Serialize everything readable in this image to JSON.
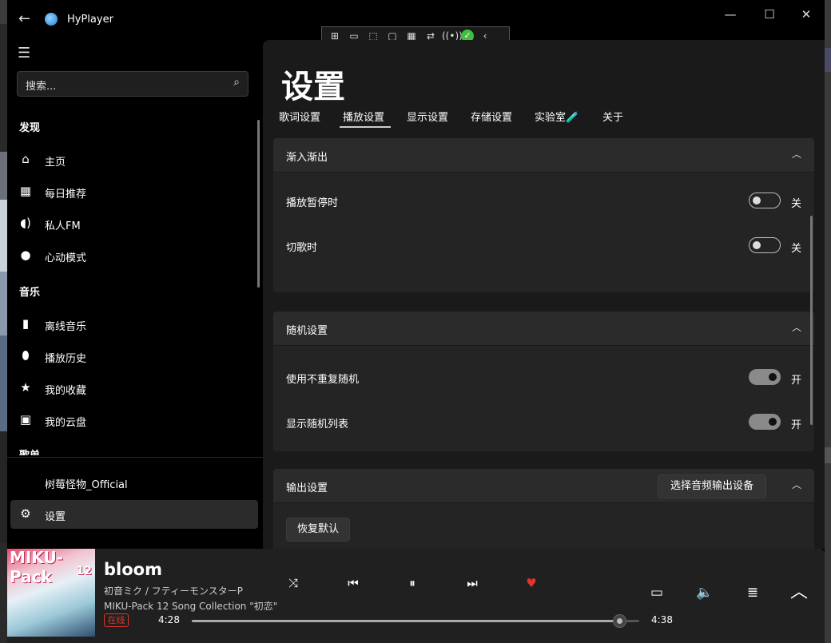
{
  "window": {
    "title": "HyPlayer"
  },
  "sidebar": {
    "search_placeholder": "搜索...",
    "sections": {
      "discover": "发现",
      "music": "音乐",
      "playlists": "歌单"
    },
    "discover_items": [
      {
        "label": "主页",
        "icon": "home-icon"
      },
      {
        "label": "每日推荐",
        "icon": "calendar-icon"
      },
      {
        "label": "私人FM",
        "icon": "radio-icon"
      },
      {
        "label": "心动模式",
        "icon": "lightbulb-icon"
      }
    ],
    "music_items": [
      {
        "label": "离线音乐",
        "icon": "document-icon"
      },
      {
        "label": "播放历史",
        "icon": "location-icon"
      },
      {
        "label": "我的收藏",
        "icon": "star-icon"
      },
      {
        "label": "我的云盘",
        "icon": "briefcase-icon"
      }
    ],
    "user": "树莓怪物_Official",
    "settings": "设置"
  },
  "content": {
    "title": "设置",
    "tabs": [
      "歌词设置",
      "播放设置",
      "显示设置",
      "存储设置",
      "实验室🧪",
      "关于"
    ],
    "active_tab_index": 1,
    "fade": {
      "title": "渐入渐出",
      "rows": [
        {
          "label": "播放暂停时",
          "on": false,
          "state": "关"
        },
        {
          "label": "切歌时",
          "on": false,
          "state": "关"
        }
      ]
    },
    "shuffle": {
      "title": "随机设置",
      "rows": [
        {
          "label": "使用不重复随机",
          "on": true,
          "state": "开"
        },
        {
          "label": "显示随机列表",
          "on": true,
          "state": "开"
        }
      ]
    },
    "output": {
      "title": "输出设置",
      "select_device": "选择音频输出设备",
      "restore": "恢复默认"
    }
  },
  "player": {
    "cover_text": "MIKU-Pack",
    "cover_num": "12",
    "song": "bloom",
    "artist": "初音ミク / フティーモンスターP",
    "album": "MIKU-Pack 12 Song Collection \"初恋\"",
    "badge": "在线",
    "current_time": "4:28",
    "total_time": "4:38",
    "progress": 0.955,
    "liked": true,
    "accent": "#e0352b"
  }
}
